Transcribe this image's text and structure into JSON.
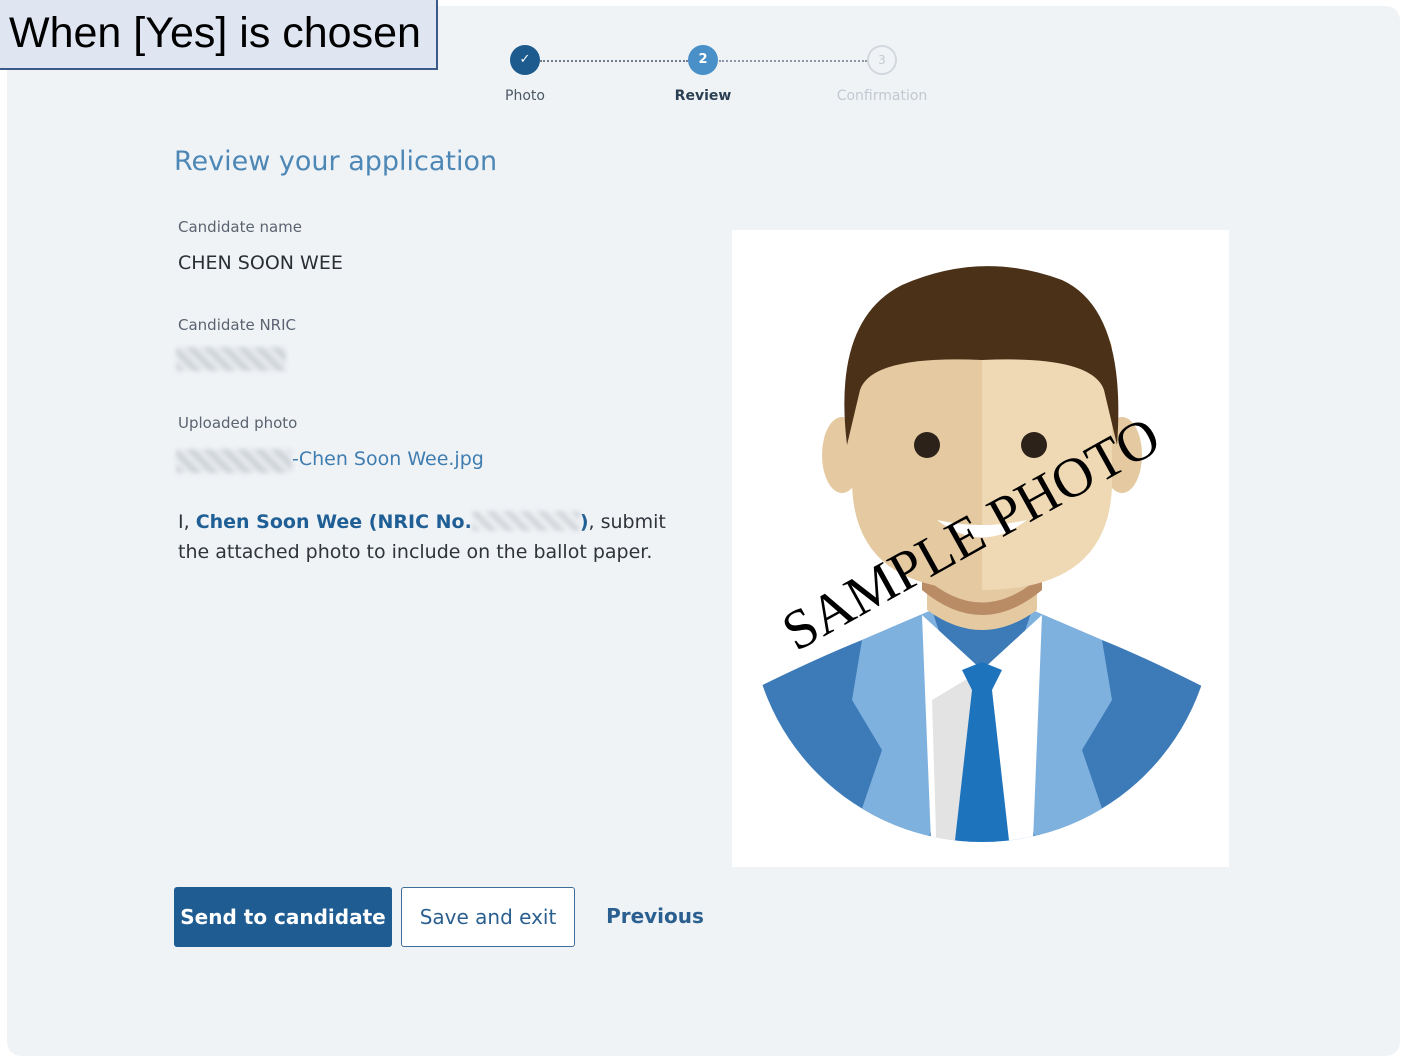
{
  "banner": {
    "text": "When [Yes] is chosen"
  },
  "stepper": {
    "steps": [
      {
        "label": "Photo",
        "marker": "✓",
        "state": "completed"
      },
      {
        "label": "Review",
        "marker": "2",
        "state": "active"
      },
      {
        "label": "Confirmation",
        "marker": "3",
        "state": "upcoming"
      }
    ]
  },
  "page": {
    "title": "Review your application"
  },
  "fields": {
    "candidate_name_label": "Candidate name",
    "candidate_name_value": "CHEN SOON WEE",
    "candidate_nric_label": "Candidate NRIC",
    "uploaded_photo_label": "Uploaded photo",
    "uploaded_photo_filename_suffix": "-Chen Soon Wee.jpg"
  },
  "declaration": {
    "prefix": "I, ",
    "name_part": "Chen Soon Wee (NRIC No.",
    "close_paren": ")",
    "suffix": ", submit the attached photo to include on the ballot paper."
  },
  "photo": {
    "watermark": "SAMPLE PHOTO"
  },
  "buttons": {
    "send": "Send to candidate",
    "save_exit": "Save and exit",
    "previous": "Previous"
  },
  "colors": {
    "accent": "#1f5c92",
    "title": "#4d87b6",
    "background": "#f0f3f6"
  }
}
